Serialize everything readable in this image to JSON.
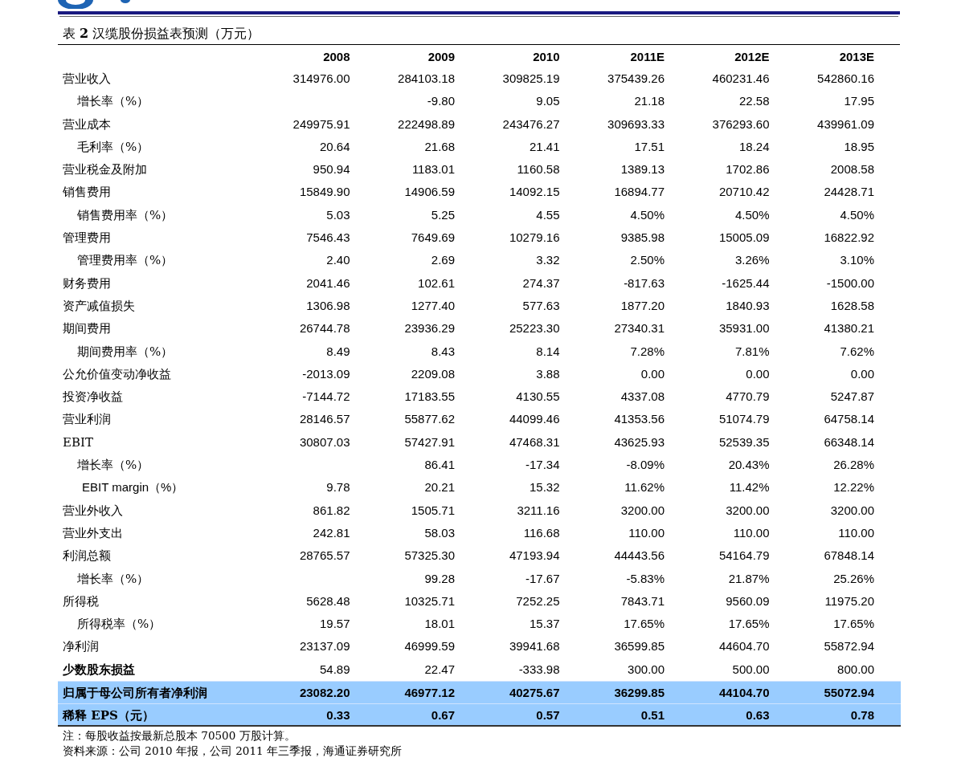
{
  "title": "表 **2** 汉缆股份损益表预测（万元）",
  "table": {
    "columns": [
      "2008",
      "2009",
      "2010",
      "2011E",
      "2012E",
      "2013E"
    ],
    "rows": [
      {
        "kind": "plain",
        "label": "营业收入",
        "values": {
          "col_1": "314976.00",
          "col_2": "284103.18",
          "col_3": "309825.19",
          "col_4": "375439.26",
          "col_5": "460231.46",
          "col_6": "542860.16"
        }
      },
      {
        "kind": "sub",
        "label": "增长率（%）",
        "values": {
          "col_2": "-9.80",
          "col_3": "9.05",
          "col_4": "21.18",
          "col_5": "22.58",
          "col_6": "17.95"
        }
      },
      {
        "kind": "plain",
        "label": "营业成本",
        "values": {
          "col_1": "249975.91",
          "col_2": "222498.89",
          "col_3": "243476.27",
          "col_4": "309693.33",
          "col_5": "376293.60",
          "col_6": "439961.09"
        }
      },
      {
        "kind": "sub",
        "label": "毛利率（%）",
        "values": {
          "col_1": "20.64",
          "col_2": "21.68",
          "col_3": "21.41",
          "col_4": "17.51",
          "col_5": "18.24",
          "col_6": "18.95"
        }
      },
      {
        "kind": "plain",
        "label": "营业税金及附加",
        "values": {
          "col_1": "950.94",
          "col_2": "1183.01",
          "col_3": "1160.58",
          "col_4": "1389.13",
          "col_5": "1702.86",
          "col_6": "2008.58"
        }
      },
      {
        "kind": "plain",
        "label": "销售费用",
        "values": {
          "col_1": "15849.90",
          "col_2": "14906.59",
          "col_3": "14092.15",
          "col_4": "16894.77",
          "col_5": "20710.42",
          "col_6": "24428.71"
        }
      },
      {
        "kind": "sub",
        "label": "销售费用率（%）",
        "values": {
          "col_1": "5.03",
          "col_2": "5.25",
          "col_3": "4.55",
          "col_4": "4.50%",
          "col_5": "4.50%",
          "col_6": "4.50%"
        }
      },
      {
        "kind": "plain",
        "label": "管理费用",
        "values": {
          "col_1": "7546.43",
          "col_2": "7649.69",
          "col_3": "10279.16",
          "col_4": "9385.98",
          "col_5": "15005.09",
          "col_6": "16822.92"
        }
      },
      {
        "kind": "sub",
        "label": "管理费用率（%）",
        "values": {
          "col_1": "2.40",
          "col_2": "2.69",
          "col_3": "3.32",
          "col_4": "2.50%",
          "col_5": "3.26%",
          "col_6": "3.10%"
        }
      },
      {
        "kind": "plain",
        "label": "财务费用",
        "values": {
          "col_1": "2041.46",
          "col_2": "102.61",
          "col_3": "274.37",
          "col_4": "-817.63",
          "col_5": "-1625.44",
          "col_6": "-1500.00"
        }
      },
      {
        "kind": "plain",
        "label": "资产减值损失",
        "values": {
          "col_1": "1306.98",
          "col_2": "1277.40",
          "col_3": "577.63",
          "col_4": "1877.20",
          "col_5": "1840.93",
          "col_6": "1628.58"
        }
      },
      {
        "kind": "plain",
        "label": "期间费用",
        "values": {
          "col_1": "26744.78",
          "col_2": "23936.29",
          "col_3": "25223.30",
          "col_4": "27340.31",
          "col_5": "35931.00",
          "col_6": "41380.21"
        }
      },
      {
        "kind": "sub",
        "label": "期间费用率（%）",
        "values": {
          "col_1": "8.49",
          "col_2": "8.43",
          "col_3": "8.14",
          "col_4": "7.28%",
          "col_5": "7.81%",
          "col_6": "7.62%"
        }
      },
      {
        "kind": "plain",
        "label": "公允价值变动净收益",
        "values": {
          "col_1": "-2013.09",
          "col_2": "2209.08",
          "col_3": "3.88",
          "col_4": "0.00",
          "col_5": "0.00",
          "col_6": "0.00"
        }
      },
      {
        "kind": "plain",
        "label": "投资净收益",
        "values": {
          "col_1": "-7144.72",
          "col_2": "17183.55",
          "col_3": "4130.55",
          "col_4": "4337.08",
          "col_5": "4770.79",
          "col_6": "5247.87"
        }
      },
      {
        "kind": "plain",
        "label": "营业利润",
        "values": {
          "col_1": "28146.57",
          "col_2": "55877.62",
          "col_3": "44099.46",
          "col_4": "41353.56",
          "col_5": "51074.79",
          "col_6": "64758.14"
        }
      },
      {
        "kind": "plain",
        "label": "EBIT",
        "values": {
          "col_1": "30807.03",
          "col_2": "57427.91",
          "col_3": "47468.31",
          "col_4": "43625.93",
          "col_5": "52539.35",
          "col_6": "66348.14"
        }
      },
      {
        "kind": "sub",
        "label": "增长率（%）",
        "values": {
          "col_2": "86.41",
          "col_3": "-17.34",
          "col_4": "-8.09%",
          "col_5": "20.43%",
          "col_6": "26.28%"
        }
      },
      {
        "kind": "deep",
        "label": "EBIT margin（%）",
        "values": {
          "col_1": "9.78",
          "col_2": "20.21",
          "col_3": "15.32",
          "col_4": "11.62%",
          "col_5": "11.42%",
          "col_6": "12.22%"
        }
      },
      {
        "kind": "plain",
        "label": "营业外收入",
        "values": {
          "col_1": "861.82",
          "col_2": "1505.71",
          "col_3": "3211.16",
          "col_4": "3200.00",
          "col_5": "3200.00",
          "col_6": "3200.00"
        }
      },
      {
        "kind": "plain",
        "label": "营业外支出",
        "values": {
          "col_1": "242.81",
          "col_2": "58.03",
          "col_3": "116.68",
          "col_4": "110.00",
          "col_5": "110.00",
          "col_6": "110.00"
        }
      },
      {
        "kind": "plain",
        "label": "利润总额",
        "values": {
          "col_1": "28765.57",
          "col_2": "57325.30",
          "col_3": "47193.94",
          "col_4": "44443.56",
          "col_5": "54164.79",
          "col_6": "67848.14"
        }
      },
      {
        "kind": "sub",
        "label": "增长率（%）",
        "values": {
          "col_2": "99.28",
          "col_3": "-17.67",
          "col_4": "-5.83%",
          "col_5": "21.87%",
          "col_6": "25.26%"
        }
      },
      {
        "kind": "plain",
        "label": "所得税",
        "values": {
          "col_1": "5628.48",
          "col_2": "10325.71",
          "col_3": "7252.25",
          "col_4": "7843.71",
          "col_5": "9560.09",
          "col_6": "11975.20"
        }
      },
      {
        "kind": "sub",
        "label": "所得税率（%）",
        "values": {
          "col_1": "19.57",
          "col_2": "18.01",
          "col_3": "15.37",
          "col_4": "17.65%",
          "col_5": "17.65%",
          "col_6": "17.65%"
        }
      },
      {
        "kind": "plain",
        "label": "净利润",
        "values": {
          "col_1": "23137.09",
          "col_2": "46999.59",
          "col_3": "39941.68",
          "col_4": "36599.85",
          "col_5": "44604.70",
          "col_6": "55872.94"
        }
      },
      {
        "kind": "boldlabel",
        "label": "少数股东损益",
        "values": {
          "col_1": "54.89",
          "col_2": "22.47",
          "col_3": "-333.98",
          "col_4": "300.00",
          "col_5": "500.00",
          "col_6": "800.00"
        }
      },
      {
        "kind": "highlight",
        "label": "归属于母公司所有者净利润",
        "values": {
          "col_1": "23082.20",
          "col_2": "46977.12",
          "col_3": "40275.67",
          "col_4": "36299.85",
          "col_5": "44104.70",
          "col_6": "55072.94"
        }
      },
      {
        "kind": "highlight",
        "label": "稀释 EPS（元）",
        "values": {
          "col_1": "0.33",
          "col_2": "0.67",
          "col_3": "0.57",
          "col_4": "0.51",
          "col_5": "0.63",
          "col_6": "0.78"
        }
      }
    ]
  },
  "notes": [
    "注：每股收益按最新总股本 70500 万股计算。",
    "资料来源：公司 2010 年报，公司 2011 年三季报，海通证券研究所"
  ]
}
